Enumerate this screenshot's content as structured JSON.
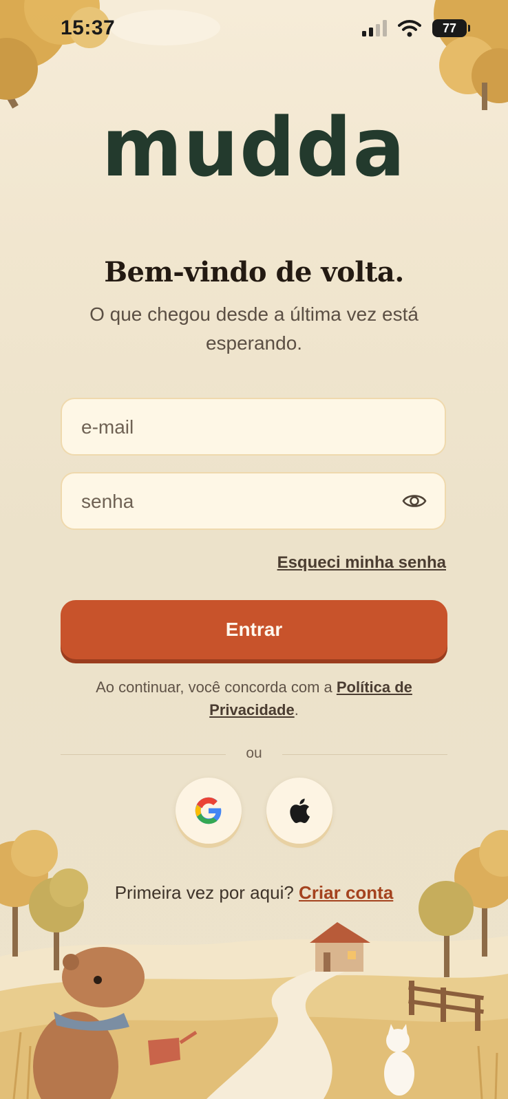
{
  "status_bar": {
    "time": "15:37",
    "battery": "77"
  },
  "logo": "mudda",
  "header": {
    "title": "Bem-vindo de volta.",
    "subtitle": "O que chegou desde a última vez está esperando."
  },
  "form": {
    "email_placeholder": "e-mail",
    "password_placeholder": "senha",
    "forgot_label": "Esqueci minha senha",
    "submit_label": "Entrar"
  },
  "legal": {
    "prefix": "Ao continuar, você concorda com a ",
    "link": "Política de Privacidade",
    "suffix": "."
  },
  "divider_label": "ou",
  "social": {
    "google_icon": "google-icon",
    "apple_icon": "apple-icon"
  },
  "signup": {
    "prompt": "Primeira vez por aqui? ",
    "link": "Criar conta"
  },
  "colors": {
    "accent": "#c8532b",
    "logo": "#233a2d",
    "background": "#ede3cc"
  }
}
